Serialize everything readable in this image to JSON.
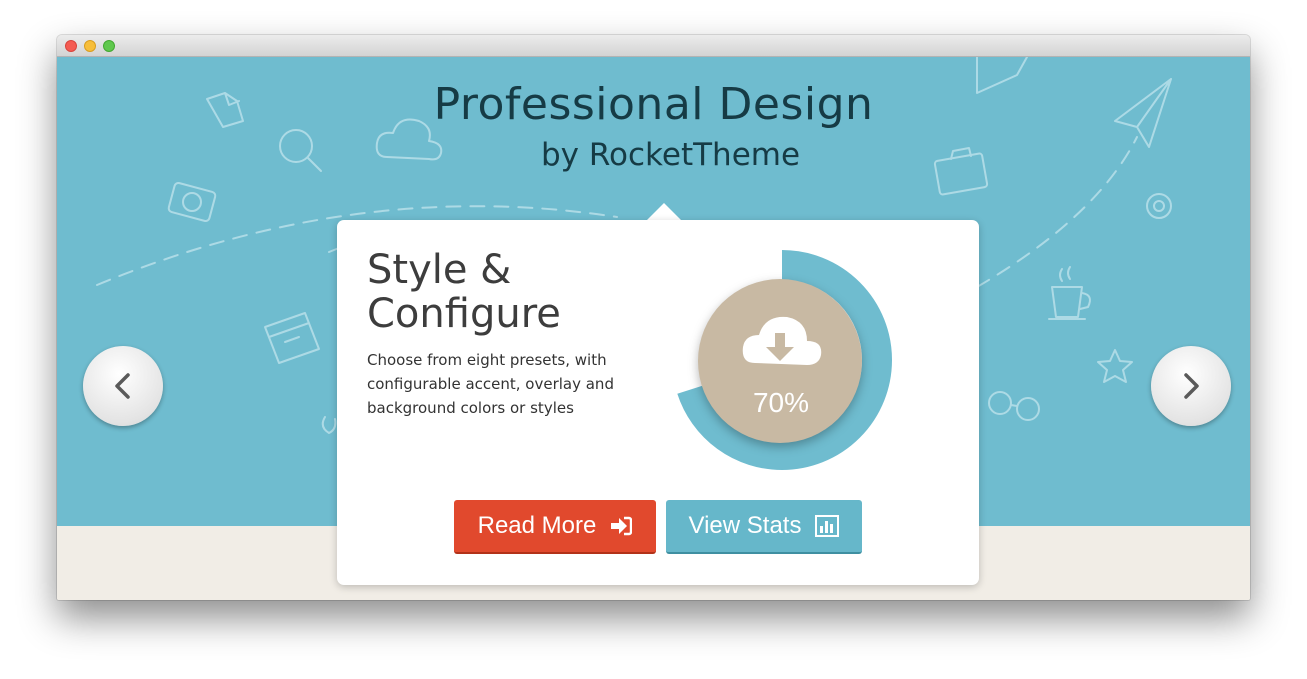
{
  "hero": {
    "title": "Professional Design",
    "subtitle": "by RocketTheme"
  },
  "card": {
    "title": "Style & Configure",
    "description": "Choose from eight presets, with configurable accent, overlay and background colors or styles",
    "progress_label": "70%",
    "progress_value": 70,
    "read_more_label": "Read More",
    "view_stats_label": "View Stats"
  },
  "navigation": {
    "prev_icon": "chevron-left-icon",
    "next_icon": "chevron-right-icon"
  },
  "icons": {
    "download": "cloud-download-icon",
    "sign_in": "sign-in-icon",
    "bar_chart": "bar-chart-icon"
  },
  "colors": {
    "hero_bg": "#6fbccf",
    "accent_red": "#e1492d",
    "accent_blue": "#66b7ca",
    "donut_inner": "#c8b9a3",
    "title_text": "#163b45"
  }
}
